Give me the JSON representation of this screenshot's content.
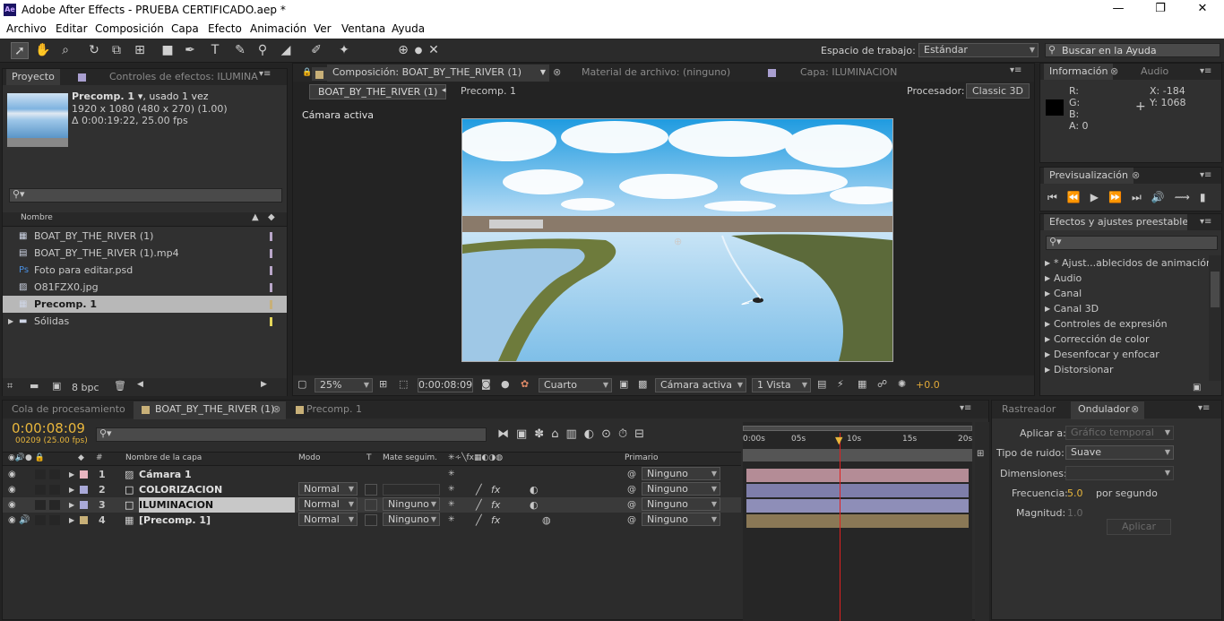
{
  "window": {
    "title": "Adobe After Effects - PRUEBA CERTIFICADO.aep *",
    "logo": "Ae",
    "min": "—",
    "max": "❐",
    "close": "✕"
  },
  "menu": [
    "Archivo",
    "Editar",
    "Composición",
    "Capa",
    "Efecto",
    "Animación",
    "Ver",
    "Ventana",
    "Ayuda"
  ],
  "toolbar": {
    "workspace_label": "Espacio de trabajo:",
    "workspace_value": "Estándar",
    "help_placeholder": "Buscar en la Ayuda"
  },
  "project": {
    "tab": "Proyecto",
    "effects_tab": "Controles de efectos: ILUMINA",
    "comp_name": "Precomp. 1 ▾",
    "used": ", usado 1 vez",
    "res": "1920 x 1080  (480 x 270) (1.00)",
    "dur": "Δ 0:00:19:22, 25.00 fps",
    "name_header": "Nombre",
    "bpc": "8 bpc",
    "items": [
      {
        "name": "BOAT_BY_THE_RIVER (1)",
        "icon": "comp-icon",
        "color": "#b9a6c9"
      },
      {
        "name": "BOAT_BY_THE_RIVER (1).mp4",
        "icon": "video-file-icon",
        "color": "#b9a6c9"
      },
      {
        "name": "Foto para editar.psd",
        "icon": "psd-file-icon",
        "color": "#b9a6c9"
      },
      {
        "name": "O81FZX0.jpg",
        "icon": "image-file-icon",
        "color": "#b9a6c9"
      },
      {
        "name": "Precomp. 1",
        "icon": "comp-icon",
        "color": "#c8b078"
      },
      {
        "name": "Sólidas",
        "icon": "folder-icon",
        "color": "#e3d55a"
      }
    ]
  },
  "comp": {
    "tab": "Composición: BOAT_BY_THE_RIVER (1)",
    "footage_tab": "Material de archivo: (ninguno)",
    "layer_tab": "Capa: ILUMINACION",
    "crumb1": "BOAT_BY_THE_RIVER (1)",
    "crumb2": "Precomp. 1",
    "renderer_label": "Procesador:",
    "renderer": "Classic 3D",
    "camera_label": "Cámara activa",
    "zoom": "25%",
    "time": "0:00:08:09",
    "res": "Cuarto",
    "view": "Cámara activa",
    "views": "1 Vista",
    "exposure": "+0.0"
  },
  "info": {
    "tab": "Información",
    "audio_tab": "Audio",
    "r": "R:",
    "g": "G:",
    "b": "B:",
    "a": "A:  0",
    "x": "X:  -184",
    "y": "Y:  1068"
  },
  "preview": {
    "tab": "Previsualización"
  },
  "effects": {
    "tab": "Efectos y ajustes preestablecidos",
    "items": [
      "* Ajust...ablecidos de animación",
      "Audio",
      "Canal",
      "Canal 3D",
      "Controles de expresión",
      "Corrección de color",
      "Desenfocar y enfocar",
      "Distorsionar"
    ]
  },
  "timeline": {
    "tabs": [
      "Cola de procesamiento",
      "BOAT_BY_THE_RIVER (1)",
      "Precomp. 1"
    ],
    "time": "0:00:08:09",
    "frames": "00209 (25.00 fps)",
    "headers": {
      "num": "#",
      "name": "Nombre de la capa",
      "mode": "Modo",
      "t": "T",
      "matte": "Mate seguim.",
      "parent": "Primario"
    },
    "ruler": [
      "0:00s",
      "05s",
      "10s",
      "15s",
      "20s"
    ],
    "layers": [
      {
        "num": "1",
        "name": "Cámara 1",
        "color": "#e8b4bf",
        "mode": "",
        "matte": "",
        "parent": "Ninguno",
        "bar": "#b48c96"
      },
      {
        "num": "2",
        "name": "COLORIZACION",
        "color": "#a9a9d8",
        "mode": "Normal",
        "matte": "",
        "parent": "Ninguno",
        "bar": "#7e7eaa"
      },
      {
        "num": "3",
        "name": "ILUMINACION",
        "color": "#a9a9d8",
        "mode": "Normal",
        "matte": "Ninguno",
        "parent": "Ninguno",
        "bar": "#8e8eb8"
      },
      {
        "num": "4",
        "name": "[Precomp. 1]",
        "color": "#c8b078",
        "mode": "Normal",
        "matte": "Ninguno",
        "parent": "Ninguno",
        "bar": "#8a7856"
      }
    ]
  },
  "wiggler": {
    "tracker_tab": "Rastreador",
    "tab": "Ondulador",
    "apply_label": "Aplicar a:",
    "apply_value": "Gráfico temporal",
    "noise_label": "Tipo de ruido:",
    "noise_value": "Suave",
    "dim_label": "Dimensiones:",
    "freq_label": "Frecuencia:",
    "freq_value": "5.0",
    "freq_unit": "por segundo",
    "mag_label": "Magnitud:",
    "mag_value": "1.0",
    "apply_btn": "Aplicar"
  }
}
